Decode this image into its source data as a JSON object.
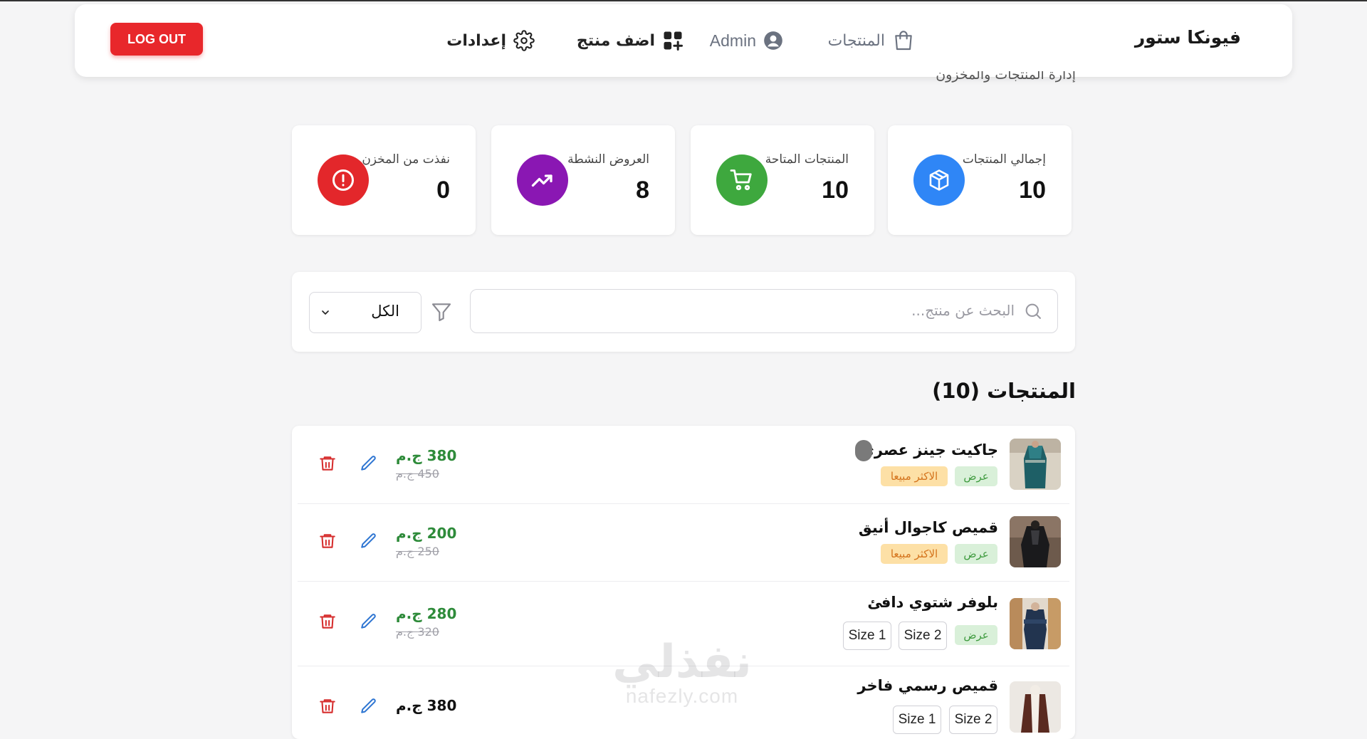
{
  "navbar": {
    "brand": "فيونكا ستور",
    "items": [
      {
        "label": "المنتجات",
        "icon": "shopping-bag-icon"
      },
      {
        "label": "Admin",
        "icon": "user-circle-icon"
      },
      {
        "label": "اضف منتج",
        "icon": "add-grid-icon"
      },
      {
        "label": "إعدادات",
        "icon": "gear-icon"
      }
    ],
    "logout_label": "LOG OUT"
  },
  "subtitle": "إدارة المنتجات والمخزون",
  "stats": [
    {
      "label": "إجمالي المنتجات",
      "value": "10",
      "icon": "box-icon",
      "color": "#2f86f6"
    },
    {
      "label": "المنتجات المتاحة",
      "value": "10",
      "icon": "cart-icon",
      "color": "#3ea83e"
    },
    {
      "label": "العروض النشطة",
      "value": "8",
      "icon": "trending-up-icon",
      "color": "#8a17b3"
    },
    {
      "label": "نفذت من المخزن",
      "value": "0",
      "icon": "alert-circle-icon",
      "color": "#e3272b"
    }
  ],
  "search": {
    "placeholder": "البحث عن منتج...",
    "filter_value": "الكل"
  },
  "section_title": "المنتجات (10)",
  "products": [
    {
      "name": "جاكيت جينز عصري",
      "badges": [
        "عرض",
        "الاكثر مبيعا"
      ],
      "sizes": [],
      "price": "380 ج.م",
      "old_price": "450 ج.م"
    },
    {
      "name": "قميص كاجوال أنيق",
      "badges": [
        "عرض",
        "الاكثر مبيعا"
      ],
      "sizes": [],
      "price": "200 ج.م",
      "old_price": "250 ج.م"
    },
    {
      "name": "بلوفر شتوي دافئ",
      "badges": [
        "عرض"
      ],
      "sizes": [
        "Size 2",
        "Size 1"
      ],
      "price": "280 ج.م",
      "old_price": "320 ج.م"
    },
    {
      "name": "قميص رسمي فاخر",
      "badges": [],
      "sizes": [
        "Size 2",
        "Size 1"
      ],
      "price": "380 ج.م",
      "old_price": ""
    }
  ],
  "watermark": {
    "ar": "نفذلي",
    "en": "nafezly.com"
  },
  "colors": {
    "accent_red": "#e8272b",
    "price_green": "#2e8b3a",
    "edit_blue": "#2f76d2",
    "delete_red": "#d62d2d"
  }
}
